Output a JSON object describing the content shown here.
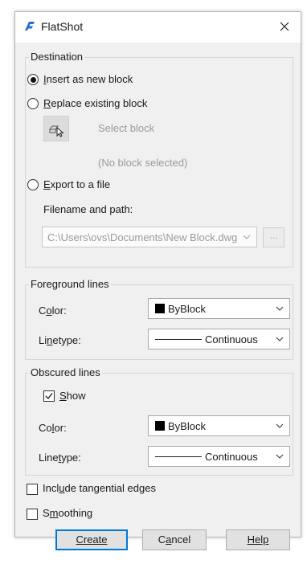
{
  "window": {
    "title": "FlatShot"
  },
  "destination": {
    "group_label": "Destination",
    "insert_new_block": "Insert as new block",
    "replace_existing_block": "Replace existing block",
    "select_block": "Select block",
    "no_block_selected": "(No block selected)",
    "export_to_file": "Export to a file",
    "filename_label": "Filename and path:",
    "filename_value": "C:\\Users\\ovs\\Documents\\New Block.dwg",
    "browse_label": "...",
    "selected_option": "Insert as new block"
  },
  "foreground": {
    "group_label": "Foreground lines",
    "color_label": "Color:",
    "color_value": "ByBlock",
    "linetype_label": "Linetype:",
    "linetype_value": "Continuous"
  },
  "obscured": {
    "group_label": "Obscured lines",
    "show_label": "Show",
    "show_checked": true,
    "color_label": "Color:",
    "color_value": "ByBlock",
    "linetype_label": "Linetype:",
    "linetype_value": "Continuous"
  },
  "options": {
    "tangential_edges": "Include tangential edges",
    "tangential_checked": false,
    "smoothing": "Smoothing",
    "smoothing_checked": false
  },
  "buttons": {
    "create": "Create",
    "cancel": "Cancel",
    "help": "Help"
  },
  "colors": {
    "accent": "#0078d7",
    "swatch": "#000000",
    "app_icon": "#1e6fd9"
  },
  "icons": [
    "flatshot-app-icon",
    "close-icon",
    "select-block-icon",
    "chevron-down-icon",
    "checkmark-icon"
  ]
}
